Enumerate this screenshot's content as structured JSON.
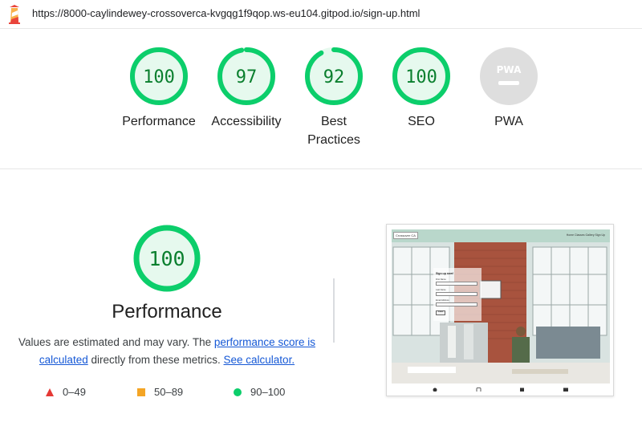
{
  "topbar": {
    "url": "https://8000-caylindewey-crossoverca-kvgqg1f9qop.ws-eu104.gitpod.io/sign-up.html"
  },
  "gauges": [
    {
      "id": "performance",
      "score": "100",
      "label": "Performance",
      "fraction": 1.0
    },
    {
      "id": "accessibility",
      "score": "97",
      "label": "Accessibility",
      "fraction": 0.97
    },
    {
      "id": "best-practices",
      "score": "92",
      "label": "Best Practices",
      "fraction": 0.92
    },
    {
      "id": "seo",
      "score": "100",
      "label": "SEO",
      "fraction": 1.0
    },
    {
      "id": "pwa",
      "score": "PWA",
      "label": "PWA",
      "fraction": 0
    }
  ],
  "performance": {
    "score": "100",
    "fraction": 1.0,
    "title": "Performance",
    "desc_prefix": "Values are estimated and may vary. The ",
    "link_score": "performance score is calculated",
    "desc_middle": " directly from these metrics. ",
    "link_calculator": "See calculator."
  },
  "legend": [
    {
      "shape": "triangle",
      "color": "#e53935",
      "label": "0–49"
    },
    {
      "shape": "square",
      "color": "#f4a525",
      "label": "50–89"
    },
    {
      "shape": "circle",
      "color": "#0cce6b",
      "label": "90–100"
    }
  ],
  "thumbnail": {
    "brand": "Crossover CA",
    "nav_links": "Home   Classes   Gallery   Sign Up",
    "form_title": "Sign up now!",
    "first_name_label": "First Name",
    "last_name_label": "Last Name",
    "email_label": "Email Address",
    "submit_label": "Submit"
  },
  "colors": {
    "pass_green": "#0cce6b",
    "pass_text": "#0a7f2e",
    "pass_fill": "#e6f9ee",
    "link_blue": "#1558d6",
    "pwa_gray": "#dedede"
  }
}
